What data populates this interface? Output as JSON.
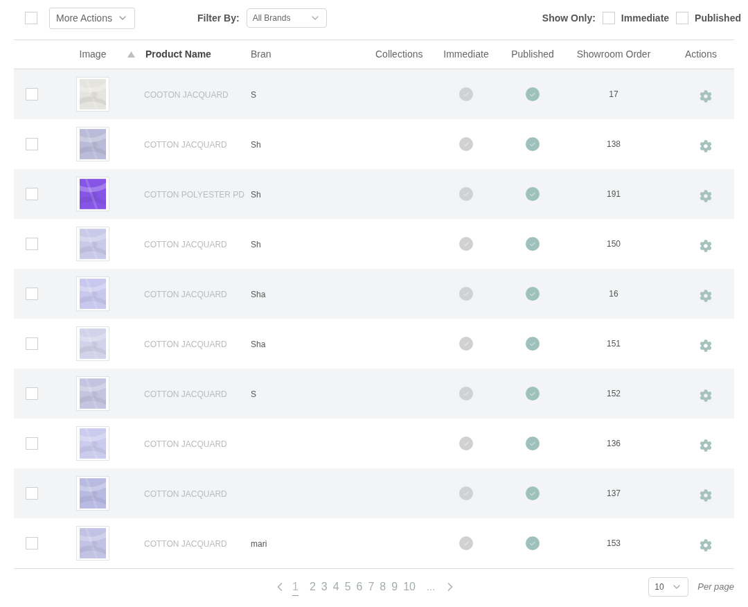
{
  "toolbar": {
    "select_all": {
      "checked": false
    },
    "more_actions": "More Actions",
    "filter_label": "Filter By:",
    "brand_filter": "All Brands",
    "show_only_label": "Show Only:",
    "show_only": [
      {
        "label": "Immediate",
        "checked": false
      },
      {
        "label": "Published",
        "checked": false
      }
    ]
  },
  "table": {
    "columns": [
      {
        "label": "Image",
        "sorted": false
      },
      {
        "label": "Product Name",
        "sorted": true
      },
      {
        "label": "Bran",
        "sorted": false
      },
      {
        "label": "Collections",
        "sorted": false
      },
      {
        "label": "Immediate",
        "sorted": false
      },
      {
        "label": "Published",
        "sorted": false
      },
      {
        "label": "Showroom Order",
        "sorted": false
      },
      {
        "label": "Actions",
        "sorted": false
      }
    ],
    "rows": [
      {
        "checked": false,
        "product": "COOTON JACQUARD",
        "brand": "S",
        "immediate": false,
        "published": true,
        "showroom_order": "17"
      },
      {
        "checked": false,
        "product": "COTTON JACQUARD",
        "brand": "Sh",
        "immediate": false,
        "published": true,
        "showroom_order": "138"
      },
      {
        "checked": false,
        "product": "COTTON POLYESTER PD",
        "brand": "Sh",
        "immediate": false,
        "published": true,
        "showroom_order": "191"
      },
      {
        "checked": false,
        "product": "COTTON JACQUARD",
        "brand": "Sh",
        "immediate": false,
        "published": true,
        "showroom_order": "150"
      },
      {
        "checked": false,
        "product": "COTTON JACQUARD",
        "brand": "Sha",
        "immediate": false,
        "published": true,
        "showroom_order": "16"
      },
      {
        "checked": false,
        "product": "COTTON JACQUARD",
        "brand": "Sha",
        "immediate": false,
        "published": true,
        "showroom_order": "151"
      },
      {
        "checked": false,
        "product": "COTTON JACQUARD",
        "brand": "S",
        "immediate": false,
        "published": true,
        "showroom_order": "152"
      },
      {
        "checked": false,
        "product": "COTTON JACQUARD",
        "immediate": false,
        "published": true,
        "showroom_order": "136"
      },
      {
        "checked": false,
        "product": "COTTON JACQUARD",
        "immediate": false,
        "published": true,
        "showroom_order": "137"
      },
      {
        "checked": false,
        "product": "COTTON JACQUARD",
        "brand": "mari",
        "immediate": false,
        "published": true,
        "showroom_order": "153"
      }
    ]
  },
  "pagination": {
    "pages": [
      {
        "label": "1",
        "selected": true
      },
      {
        "label": "2",
        "selected": false
      },
      {
        "label": "3",
        "selected": false
      },
      {
        "label": "4",
        "selected": false
      },
      {
        "label": "5",
        "selected": false
      },
      {
        "label": "6",
        "selected": false
      },
      {
        "label": "7",
        "selected": false
      },
      {
        "label": "8",
        "selected": false
      },
      {
        "label": "9",
        "selected": false
      },
      {
        "label": "10",
        "selected": false
      }
    ],
    "ellipsis": "...",
    "per_page": "10",
    "per_page_label": "Per page"
  }
}
